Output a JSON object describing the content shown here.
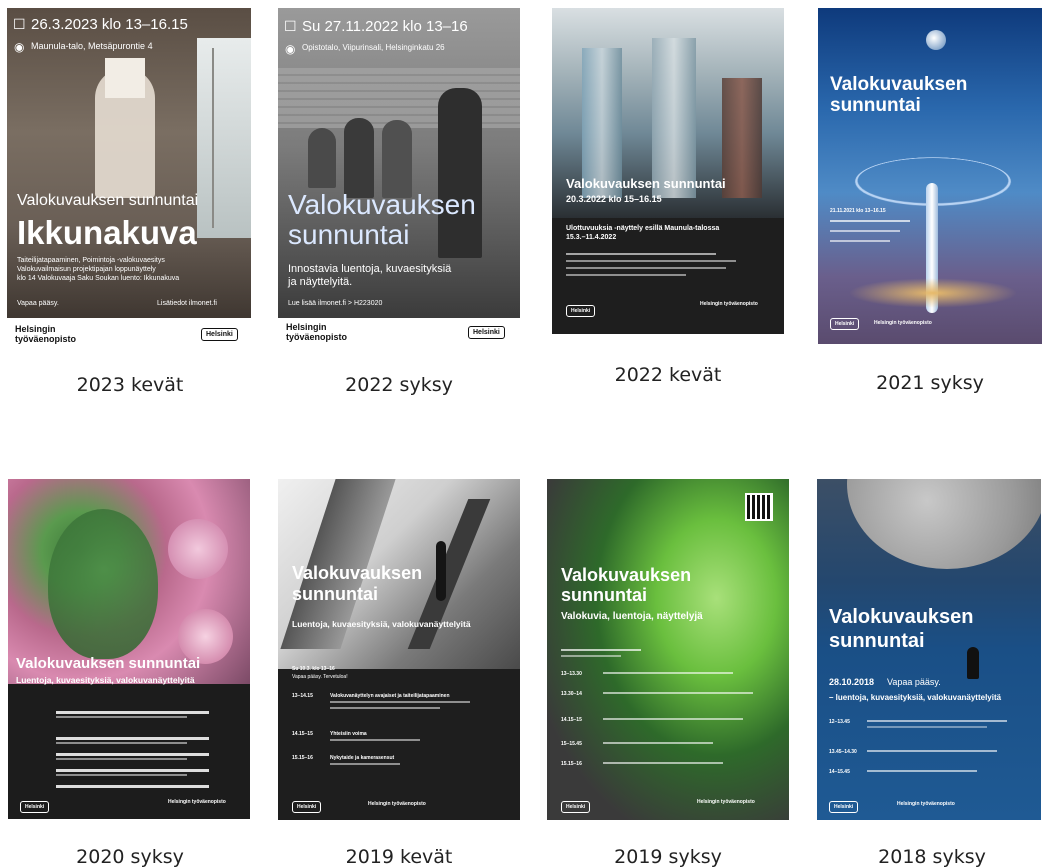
{
  "posters": [
    {
      "caption": "2023 kevät",
      "date_line": "26.3.2023 klo 13–16.15",
      "place_line": "Maunula-talo, Metsäpurontie 4",
      "title_small": "Valokuvauksen sunnuntai",
      "title_big": "Ikkunakuva",
      "desc": "Taiteilijatapaaminen, Poimintoja -valokuvaesitys\nValokuvailmaisun projektipajan loppunäyttely\nklo 14 Valokuvaaja Saku Soukan luento: Ikkunakuva",
      "free": "Vapaa pääsy.",
      "more": "Lisätiedot ilmonet.fi",
      "org": "Helsingin\ntyöväenopisto",
      "city": "Helsinki"
    },
    {
      "caption": "2022 syksy",
      "date_line": "Su 27.11.2022 klo 13–16",
      "place_line": "Opistotalo, Viipurinsali, Helsinginkatu 26",
      "title": "Valokuvauksen\nsunnuntai",
      "sub": "Innostavia luentoja, kuvaesityksiä\nja näyttelyitä.",
      "more": "Lue lisää ilmonet.fi > H223020",
      "org": "Helsingin\ntyöväenopisto",
      "city": "Helsinki"
    },
    {
      "caption": "2022 kevät",
      "title": "Valokuvauksen sunnuntai",
      "date": "20.3.2022 klo 15–16.15",
      "sub": "Ulottuvuuksia -näyttely esillä Maunula-talossa\n15.3.–11.4.2022",
      "city": "Helsinki",
      "org": "Helsingin työväenopisto"
    },
    {
      "caption": "2021 syksy",
      "title": "Valokuvauksen\nsunnuntai",
      "date": "21.11.2021 klo 13–16.15",
      "city": "Helsinki",
      "org": "Helsingin työväenopisto"
    },
    {
      "caption": "2020 syksy",
      "title": "Valokuvauksen sunnuntai",
      "sub": "Luentoja, kuvaesityksiä, valokuvanäyttelyitä",
      "city": "Helsinki",
      "org": "Helsingin työväenopisto"
    },
    {
      "caption": "2019 kevät",
      "title": "Valokuvauksen\nsunnuntai",
      "sub": "Luentoja, kuvaesityksiä, valokuvanäyttelyitä",
      "date": "Su 10.3. klo 13–16",
      "free": "Vapaa pääsy. Tervetuloa!",
      "rows": [
        {
          "time": "13–14.15",
          "label": "Valokuvanäyttelyn avajaiset ja taiteilijatapaaminen"
        },
        {
          "time": "14.15–15",
          "label": "Yhteisiin voima"
        },
        {
          "time": "15.15–16",
          "label": "Nykytaide ja kamerasensut"
        }
      ],
      "city": "Helsinki",
      "org": "Helsingin työväenopisto"
    },
    {
      "caption": "2019 syksy",
      "title": "Valokuvauksen\nsunnuntai",
      "sub": "Valokuvia, luentoja, näyttelyjä",
      "rows": [
        {
          "time": "13–13.30"
        },
        {
          "time": "13.30–14"
        },
        {
          "time": "14.15–15"
        },
        {
          "time": "15–15.45"
        },
        {
          "time": "15.15–16"
        }
      ],
      "city": "Helsinki",
      "org": "Helsingin työväenopisto"
    },
    {
      "caption": "2018 syksy",
      "title": "Valokuvauksen\nsunnuntai",
      "date": "28.10.2018",
      "free": "Vapaa pääsy.",
      "sub": "– luentoja, kuvaesityksiä, valokuvanäyttelyitä",
      "rows": [
        {
          "time": "12–13.45"
        },
        {
          "time": "13.45–14.30"
        },
        {
          "time": "14–15.45"
        }
      ],
      "city": "Helsinki",
      "org": "Helsingin työväenopisto"
    }
  ],
  "colors": {
    "page_bg": "#ffffff",
    "caption_text": "#222222",
    "dark_poster": "#1f1f1f",
    "blue_poster": "#2a5a9e"
  }
}
